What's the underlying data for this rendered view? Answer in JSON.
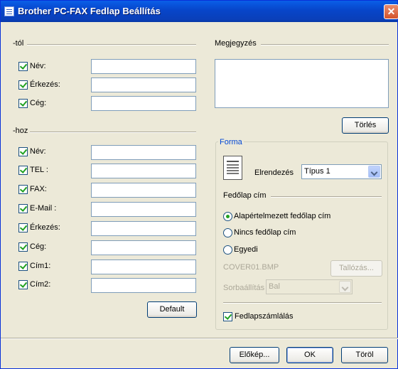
{
  "window": {
    "title": "Brother PC-FAX Fedlap Beállítás",
    "close_glyph": "✕"
  },
  "from": {
    "group_label": "-tól",
    "fields": [
      {
        "label": "Név:",
        "checked": true,
        "value": ""
      },
      {
        "label": "Érkezés:",
        "checked": true,
        "value": ""
      },
      {
        "label": "Cég:",
        "checked": true,
        "value": ""
      }
    ]
  },
  "to": {
    "group_label": "-hoz",
    "fields": [
      {
        "label": "Név:",
        "checked": true,
        "value": ""
      },
      {
        "label": "TEL :",
        "checked": true,
        "value": ""
      },
      {
        "label": "FAX:",
        "checked": true,
        "value": ""
      },
      {
        "label": "E-Mail :",
        "checked": true,
        "value": ""
      },
      {
        "label": "Érkezés:",
        "checked": true,
        "value": ""
      },
      {
        "label": "Cég:",
        "checked": true,
        "value": ""
      },
      {
        "label": "Cím1:",
        "checked": true,
        "value": ""
      },
      {
        "label": "Cím2:",
        "checked": true,
        "value": ""
      }
    ],
    "default_button": "Default"
  },
  "note": {
    "group_label": "Megjegyzés",
    "value": "",
    "clear_button": "Törlés"
  },
  "forma": {
    "legend": "Forma",
    "layout_label": "Elrendezés",
    "layout_value": "Típus 1",
    "cover_title_label": "Fedőlap cím",
    "radios": [
      {
        "label": "Alapértelmezett fedőlap cím",
        "selected": true
      },
      {
        "label": "Nincs fedőlap cím",
        "selected": false
      },
      {
        "label": "Egyedi",
        "selected": false
      }
    ],
    "file_name": "COVER01.BMP",
    "browse_button": "Tallózás...",
    "align_label": "Sorbaállítás",
    "align_value": "Bal",
    "count_label": "Fedlapszámlálás",
    "count_checked": true
  },
  "footer": {
    "preview_button": "Előkép...",
    "ok_button": "OK",
    "cancel_button": "Töröl"
  }
}
